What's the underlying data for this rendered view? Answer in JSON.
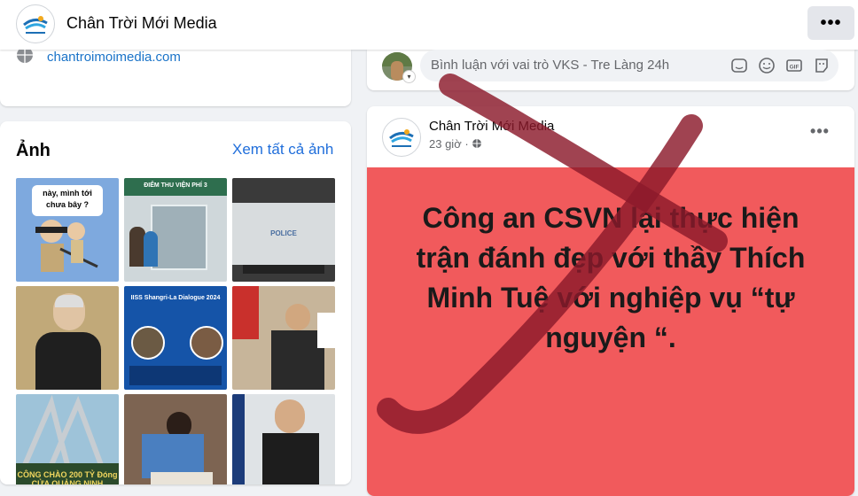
{
  "header": {
    "page_name": "Chân Trời Mới Media",
    "more_icon": "more-horizontal-icon"
  },
  "intro": {
    "website": "chantroimoimedia.com",
    "website_icon": "globe-icon"
  },
  "photos": {
    "title": "Ảnh",
    "see_all": "Xem tất cả ảnh",
    "items": [
      {
        "label": "này, mình tới chưa bây ?"
      },
      {
        "label": "ĐIỂM THU VIỆN PHÍ 3"
      },
      {
        "label": "POLICE"
      },
      {
        "label": ""
      },
      {
        "label": "IISS Shangri-La Dialogue 2024"
      },
      {
        "label": ""
      },
      {
        "label": "CÔNG CHÀO 200 TỶ Đóng CỬA QUẢNG NINH"
      },
      {
        "label": ""
      },
      {
        "label": ""
      }
    ]
  },
  "comment_box": {
    "placeholder": "Bình luận với vai trò VKS - Tre Làng 24h",
    "icons": [
      "sticker-icon",
      "emoji-icon",
      "gif-icon",
      "avatar-sticker-icon"
    ]
  },
  "post": {
    "author": "Chân Trời Mới Media",
    "time": "23 giờ · ",
    "privacy_icon": "globe-icon",
    "text": "Công an CSVN lại thực hiện trận đánh đẹp với thầy Thích Minh Tuệ với nghiệp vụ “tự nguyện “.",
    "banner_color": "#f15a5c"
  },
  "colors": {
    "link": "#216fdb",
    "overlay_x": "#8b1a2b"
  }
}
